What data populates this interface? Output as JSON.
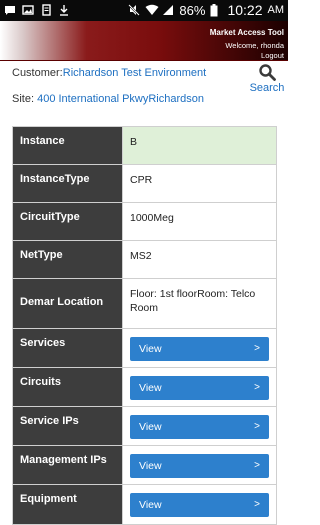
{
  "status_bar": {
    "battery_pct": "86%",
    "time": "10:22",
    "ampm": "AM"
  },
  "header": {
    "title": "Market Access Tool",
    "welcome": "Welcome, rhonda",
    "logout": "Logout"
  },
  "site_info": {
    "customer_label": "Customer:",
    "customer_value": "Richardson Test Environment",
    "site_label": "Site: ",
    "site_value": "400 International PkwyRichardson"
  },
  "search": {
    "label": "Search"
  },
  "table": {
    "rows": [
      {
        "label": "Instance",
        "value": "B"
      },
      {
        "label": "InstanceType",
        "value": "CPR"
      },
      {
        "label": "CircuitType",
        "value": "1000Meg"
      },
      {
        "label": "NetType",
        "value": "MS2"
      },
      {
        "label": "Demar Location",
        "value": "Floor: 1st floorRoom: Telco Room"
      },
      {
        "label": "Services",
        "button": "View",
        "arrow": ">"
      },
      {
        "label": "Circuits",
        "button": "View",
        "arrow": ">"
      },
      {
        "label": "Service IPs",
        "button": "View",
        "arrow": ">"
      },
      {
        "label": "Management IPs",
        "button": "View",
        "arrow": ">"
      },
      {
        "label": "Equipment",
        "button": "View",
        "arrow": ">"
      }
    ]
  }
}
